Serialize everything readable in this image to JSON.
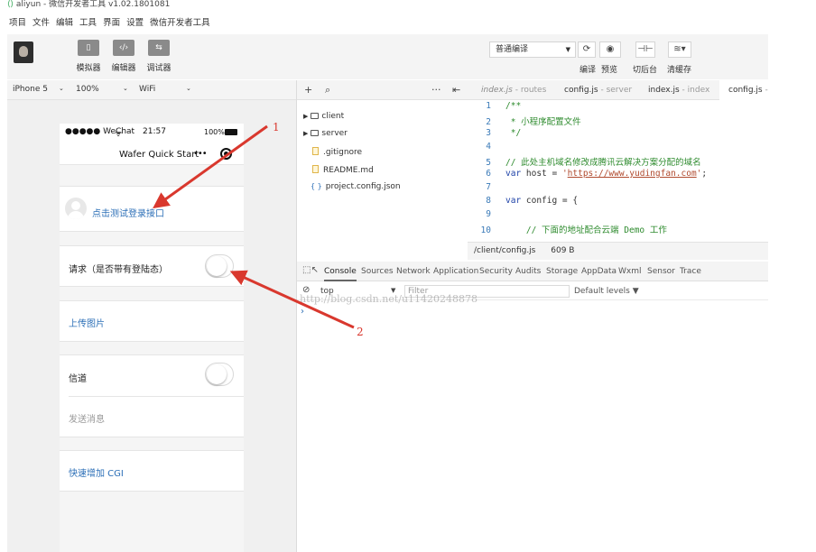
{
  "window_title": "aliyun - 微信开发者工具 v1.02.1801081",
  "menu": [
    "项目",
    "文件",
    "编辑",
    "工具",
    "界面",
    "设置",
    "微信开发者工具"
  ],
  "toolbar": {
    "simulator_label": "模拟器",
    "editor_label": "编辑器",
    "debugger_label": "调试器",
    "compile_mode": "普通编译",
    "compile_label": "编译",
    "preview_label": "预览",
    "backend_label": "切后台",
    "clear_cache_label": "清缓存"
  },
  "device_bar": {
    "device": "iPhone 5",
    "zoom": "100%",
    "network": "WiFi"
  },
  "phone": {
    "carrier": "●●●●● WeChat",
    "time": "21:57",
    "battery": "100%",
    "nav_title": "Wafer Quick Start",
    "login_link": "点击测试登录接口",
    "request_label": "请求（是否带有登陆态）",
    "upload_link": "上传图片",
    "tunnel_label": "信道",
    "send_message": "发送消息",
    "add_cgi_link": "快速增加 CGI"
  },
  "editor": {
    "tabs": [
      {
        "name": "index.js",
        "sub": " - routes"
      },
      {
        "name": "config.js",
        "sub": " - server"
      },
      {
        "name": "index.js",
        "sub": " - index"
      },
      {
        "name": "config.js",
        "sub": " - c"
      }
    ],
    "file_tree": [
      "client",
      "server",
      ".gitignore",
      "README.md",
      "project.config.json"
    ],
    "code": {
      "l1": "/**",
      "l2": " * 小程序配置文件",
      "l3": " */",
      "l5": "// 此处主机域名修改成腾讯云解决方案分配的域名",
      "l6_kw": "var",
      "l6_mid": " host = ",
      "l6_q1": "'",
      "l6_url": "https://www.yudingfan.com",
      "l6_q2": "'",
      "l6_end": ";",
      "l8_kw": "var",
      "l8_rest": " config = {",
      "l10": "    // 下面的地址配合云端 Demo 工作"
    },
    "path": "/client/config.js",
    "size": "609 B"
  },
  "devtools": {
    "tabs": [
      "Console",
      "Sources",
      "Network",
      "Application",
      "Security",
      "Audits",
      "Storage",
      "AppData",
      "Wxml",
      "Sensor",
      "Trace"
    ],
    "context": "top",
    "filter_placeholder": "Filter",
    "levels": "Default levels ▼",
    "prompt": "›",
    "watermark": "http://blog.csdn.net/u11420248878"
  },
  "annotations": {
    "label1": "1",
    "label2": "2"
  },
  "colors": {
    "annotation": "#d9382e",
    "link": "#2c6fb7",
    "toolbar_bg": "#f4f4f4"
  }
}
